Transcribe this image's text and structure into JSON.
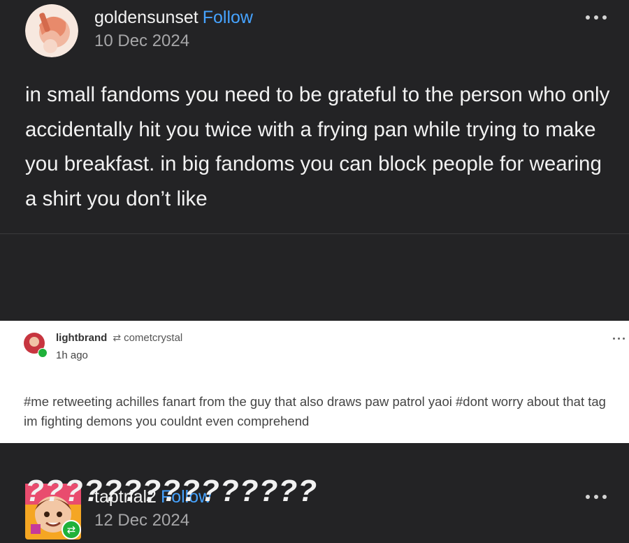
{
  "post1": {
    "username": "goldensunset",
    "follow_label": "Follow",
    "date": "10 Dec 2024",
    "text": "in small fandoms you need to be grateful to the person who only accidentally hit you twice with a frying pan while trying to make you breakfast. in big fandoms you can block people for wearing a shirt you don’t like",
    "avatar_icon": "peach-avatar-icon",
    "menu_icon": "more-dots-icon"
  },
  "post2": {
    "username": "taptrial2",
    "follow_label": "Follow",
    "date": "12 Dec 2024",
    "avatar_icon": "cartoon-avatar-icon",
    "badge_icon": "reblog-icon",
    "menu_icon": "more-dots-icon"
  },
  "embed": {
    "username": "lightbrand",
    "reblog_icon": "reblog-icon",
    "reblogged_from": "cometcrystal",
    "time": "1h ago",
    "tags": "#me retweeting achilles fanart from the guy that also draws paw patrol yaoi  #dont worry about that tag im fighting demons you couldnt even comprehend"
  },
  "reply": {
    "text": "???????????????"
  },
  "colors": {
    "background": "#232325",
    "follow": "#46a3ff",
    "badge_green": "#1fb13a"
  }
}
